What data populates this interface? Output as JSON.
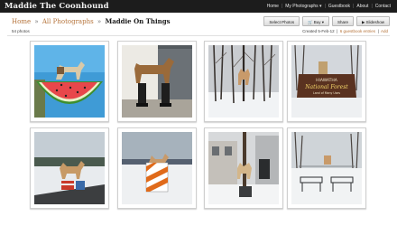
{
  "header": {
    "site_title": "Maddie The Coonhound",
    "nav": [
      {
        "label": "Home"
      },
      {
        "label": "My Photographs ▾"
      },
      {
        "label": "Guestbook"
      },
      {
        "label": "About"
      },
      {
        "label": "Contact"
      }
    ]
  },
  "breadcrumb": {
    "home": "Home",
    "all_photos": "All Photographs",
    "current": "Maddie On Things",
    "separator": "»"
  },
  "toolbar": {
    "select_photos": "Select Photos",
    "buy": "Buy ▾",
    "share": "Share",
    "slideshow": "Slideshow"
  },
  "gallery": {
    "photo_count": "54 photos",
    "created": "Created 5-Feb-12",
    "guestbook_entries": "6 guestbook entries",
    "add": "Add"
  },
  "photos": [
    {
      "subject": "watermelon"
    },
    {
      "subject": "rain-boots"
    },
    {
      "subject": "snowy-woods"
    },
    {
      "subject": "hiawatha-sign",
      "sign_line1": "HIAWATHA",
      "sign_line2": "National Forest",
      "sign_line3": "Land of Many Uses"
    },
    {
      "subject": "road-barrels"
    },
    {
      "subject": "striped-barricade"
    },
    {
      "subject": "house-post"
    },
    {
      "subject": "park-benches"
    }
  ],
  "colors": {
    "topbar": "#1c1c1c",
    "accent_link": "#b5733a",
    "button_border": "#b8b8b8"
  }
}
